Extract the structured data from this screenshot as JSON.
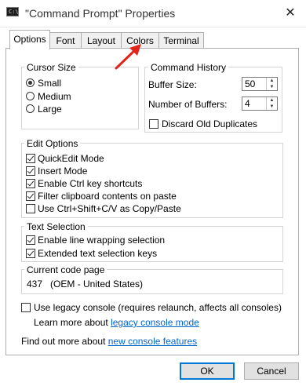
{
  "window": {
    "title": "\"Command Prompt\" Properties",
    "icon_text": "C:\\",
    "close_glyph": "✕"
  },
  "tabs": [
    {
      "label": "Options",
      "active": true
    },
    {
      "label": "Font"
    },
    {
      "label": "Layout"
    },
    {
      "label": "Colors"
    },
    {
      "label": "Terminal"
    }
  ],
  "cursor_size": {
    "legend": "Cursor Size",
    "options": [
      {
        "label": "Small",
        "selected": true
      },
      {
        "label": "Medium",
        "selected": false
      },
      {
        "label": "Large",
        "selected": false
      }
    ]
  },
  "command_history": {
    "legend": "Command History",
    "buffer_size_label": "Buffer Size:",
    "buffer_size_value": "50",
    "num_buffers_label": "Number of Buffers:",
    "num_buffers_value": "4",
    "discard_label": "Discard Old Duplicates",
    "discard_checked": false
  },
  "edit_options": {
    "legend": "Edit Options",
    "items": [
      {
        "label": "QuickEdit Mode",
        "checked": true
      },
      {
        "label": "Insert Mode",
        "checked": true
      },
      {
        "label": "Enable Ctrl key shortcuts",
        "checked": true
      },
      {
        "label": "Filter clipboard contents on paste",
        "checked": true
      },
      {
        "label": "Use Ctrl+Shift+C/V as Copy/Paste",
        "checked": false
      }
    ]
  },
  "text_selection": {
    "legend": "Text Selection",
    "items": [
      {
        "label": "Enable line wrapping selection",
        "checked": true
      },
      {
        "label": "Extended text selection keys",
        "checked": true
      }
    ]
  },
  "code_page": {
    "legend": "Current code page",
    "value": "437   (OEM - United States)"
  },
  "legacy": {
    "label": "Use legacy console (requires relaunch, affects all consoles)",
    "checked": false,
    "learn_prefix": "Learn more about ",
    "learn_link": "legacy console mode"
  },
  "features": {
    "prefix": "Find out more about ",
    "link": "new console features"
  },
  "buttons": {
    "ok": "OK",
    "cancel": "Cancel"
  },
  "colors": {
    "accent": "#0078d7",
    "link": "#0066cc",
    "arrow": "#e0251b"
  }
}
